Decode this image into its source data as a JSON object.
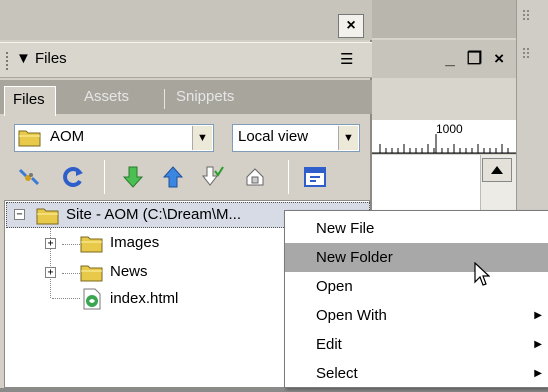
{
  "panel": {
    "close_glyph": "×",
    "title": "▼ Files",
    "options_glyph": "☰",
    "tabs": [
      {
        "label": "Files",
        "active": true
      },
      {
        "label": "Assets",
        "active": false
      },
      {
        "label": "Snippets",
        "active": false
      }
    ],
    "site_select": {
      "value": "AOM"
    },
    "view_select": {
      "value": "Local view"
    },
    "toolbar": [
      "connect-icon",
      "refresh-icon",
      "get-icon",
      "put-icon",
      "check-out-icon",
      "check-in-icon",
      "expand-icon"
    ]
  },
  "tree": {
    "root": {
      "label": "Site - AOM (C:\\Dream\\M...",
      "expander": "−"
    },
    "items": [
      {
        "label": "Images",
        "type": "folder",
        "expander": "+"
      },
      {
        "label": "News",
        "type": "folder",
        "expander": "+"
      },
      {
        "label": "index.html",
        "type": "file",
        "expander": ""
      }
    ]
  },
  "document_window": {
    "buttons": {
      "minimize": "_",
      "restore": "❐",
      "close": "×"
    },
    "ruler_label": "1000"
  },
  "context_menu": {
    "items": [
      {
        "label": "New File",
        "submenu": false,
        "highlighted": false
      },
      {
        "label": "New Folder",
        "submenu": false,
        "highlighted": true
      },
      {
        "label": "Open",
        "submenu": false,
        "highlighted": false
      },
      {
        "label": "Open With",
        "submenu": true,
        "highlighted": false
      },
      {
        "label": "Edit",
        "submenu": true,
        "highlighted": false
      },
      {
        "label": "Select",
        "submenu": true,
        "highlighted": false
      }
    ],
    "submenu_glyph": "▶"
  },
  "colors": {
    "folder": "#e8c94a",
    "highlight": "#a8a8a8",
    "selection": "#d6dbe6",
    "panel_bg": "#d4d0c8"
  }
}
